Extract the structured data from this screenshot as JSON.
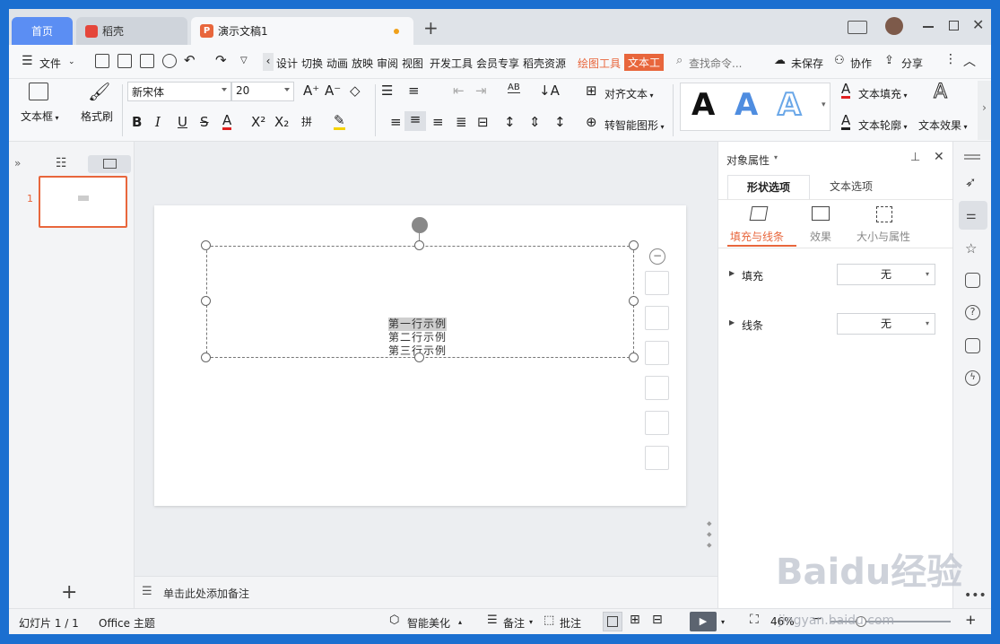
{
  "tabs": {
    "home": "首页",
    "daoke": "稻壳",
    "doc": "演示文稿1"
  },
  "window": {
    "new_tab": "+"
  },
  "menu": {
    "file": "文件",
    "items": [
      "设计",
      "切换",
      "动画",
      "放映",
      "审阅",
      "视图",
      "开发工具",
      "会员专享",
      "稻壳资源"
    ],
    "drawing_tools": "绘图工具",
    "text_tools": "文本工",
    "search_placeholder": "查找命令...",
    "unsaved": "未保存",
    "collab": "协作",
    "share": "分享"
  },
  "ribbon": {
    "textbox": "文本框",
    "format_painter": "格式刷",
    "font_name": "新宋体",
    "font_size": "20",
    "align_text": "对齐文本",
    "smart_shape": "转智能图形",
    "text_fill": "文本填充",
    "text_outline": "文本轮廓",
    "text_effect": "文本效果",
    "gallery_letter": "A",
    "wen_label": "拼"
  },
  "left_panel": {
    "slide_number": "1",
    "add": "+"
  },
  "slide": {
    "lines": [
      "第一行示例",
      "第二行示例",
      "第三行示例"
    ]
  },
  "notes": {
    "placeholder": "单击此处添加备注"
  },
  "right_panel": {
    "title": "对象属性",
    "tab_shape": "形状选项",
    "tab_text": "文本选项",
    "sub_fill_line": "填充与线条",
    "sub_effect": "效果",
    "sub_size": "大小与属性",
    "fill_label": "填充",
    "fill_value": "无",
    "line_label": "线条",
    "line_value": "无"
  },
  "status": {
    "slide_count": "幻灯片 1 / 1",
    "theme": "Office 主题",
    "beautify": "智能美化",
    "notes": "备注",
    "comment": "批注",
    "zoom": "46%",
    "zoom_fraction": 0.46
  },
  "watermark": {
    "brand": "Baidu经验",
    "url": "jingyan.baidu.com"
  },
  "colors": {
    "accent": "#e8663c",
    "home_tab": "#5b8ef3",
    "desktop": "#1b6fd0"
  }
}
